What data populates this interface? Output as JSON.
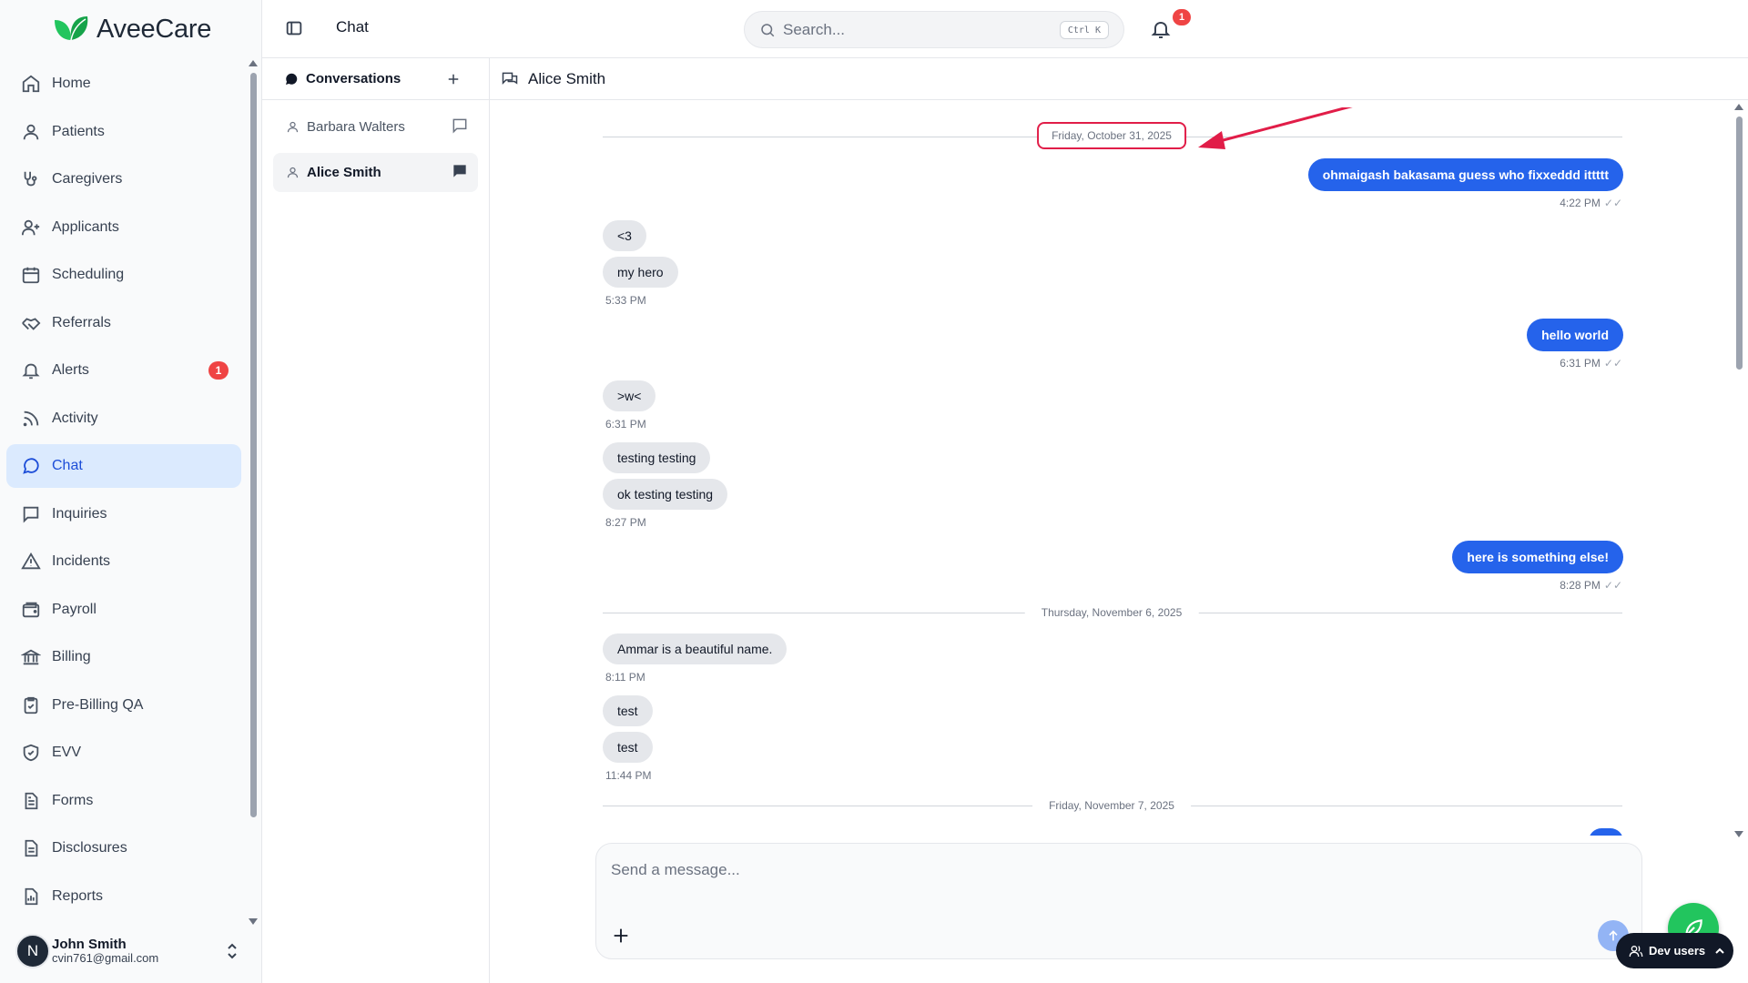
{
  "app": {
    "brand": "AveeCare",
    "accent": "#2563eb",
    "brand_green": "#22c55e"
  },
  "sidebar": {
    "items": [
      {
        "label": "Home",
        "icon": "home-icon"
      },
      {
        "label": "Patients",
        "icon": "user-icon"
      },
      {
        "label": "Caregivers",
        "icon": "stethoscope-icon"
      },
      {
        "label": "Applicants",
        "icon": "user-plus-icon"
      },
      {
        "label": "Scheduling",
        "icon": "calendar-icon"
      },
      {
        "label": "Referrals",
        "icon": "handshake-icon"
      },
      {
        "label": "Alerts",
        "icon": "bell-icon",
        "badge": "1"
      },
      {
        "label": "Activity",
        "icon": "rss-icon"
      },
      {
        "label": "Chat",
        "icon": "message-circle-icon",
        "active": true
      },
      {
        "label": "Inquiries",
        "icon": "message-square-icon"
      },
      {
        "label": "Incidents",
        "icon": "alert-triangle-icon"
      },
      {
        "label": "Payroll",
        "icon": "wallet-icon"
      },
      {
        "label": "Billing",
        "icon": "bank-icon"
      },
      {
        "label": "Pre-Billing QA",
        "icon": "clipboard-check-icon"
      },
      {
        "label": "EVV",
        "icon": "shield-check-icon"
      },
      {
        "label": "Forms",
        "icon": "file-text-icon"
      },
      {
        "label": "Disclosures",
        "icon": "file-icon"
      },
      {
        "label": "Reports",
        "icon": "file-chart-icon"
      }
    ],
    "user": {
      "initial": "N",
      "name": "John Smith",
      "email": "cvin761@gmail.com"
    }
  },
  "topbar": {
    "title": "Chat",
    "search_placeholder": "Search...",
    "search_shortcut": "Ctrl K",
    "notification_count": "1"
  },
  "conversations": {
    "title": "Conversations",
    "items": [
      {
        "name": "Barbara Walters",
        "active": false
      },
      {
        "name": "Alice Smith",
        "active": true
      }
    ]
  },
  "chat": {
    "title": "Alice Smith",
    "date_separators": [
      "Friday, October 31, 2025",
      "Thursday, November 6, 2025",
      "Friday, November 7, 2025"
    ],
    "messages": [
      {
        "dir": "out",
        "text": "ohmaigash bakasama guess who fixxeddd ittttt"
      },
      {
        "dir": "in",
        "text": "<3"
      },
      {
        "dir": "in",
        "text": "my hero"
      },
      {
        "dir": "out",
        "text": "hello world"
      },
      {
        "dir": "in",
        "text": ">w<"
      },
      {
        "dir": "in",
        "text": "testing testing"
      },
      {
        "dir": "in",
        "text": "ok testing testing"
      },
      {
        "dir": "out",
        "text": "here is something else!"
      },
      {
        "dir": "in",
        "text": "Ammar is a beautiful name."
      },
      {
        "dir": "in",
        "text": "test"
      },
      {
        "dir": "in",
        "text": "test"
      }
    ],
    "times": {
      "t1": "4:22 PM",
      "t2": "5:33 PM",
      "t3": "6:31 PM",
      "t4": "6:31 PM",
      "t5": "8:27 PM",
      "t6": "8:28 PM",
      "t7": "8:11 PM",
      "t8": "11:44 PM"
    },
    "read_ticks": "✓✓",
    "composer_placeholder": "Send a message..."
  },
  "dev_users": {
    "label": "Dev users"
  },
  "annotation": {
    "color": "#e11d48"
  }
}
